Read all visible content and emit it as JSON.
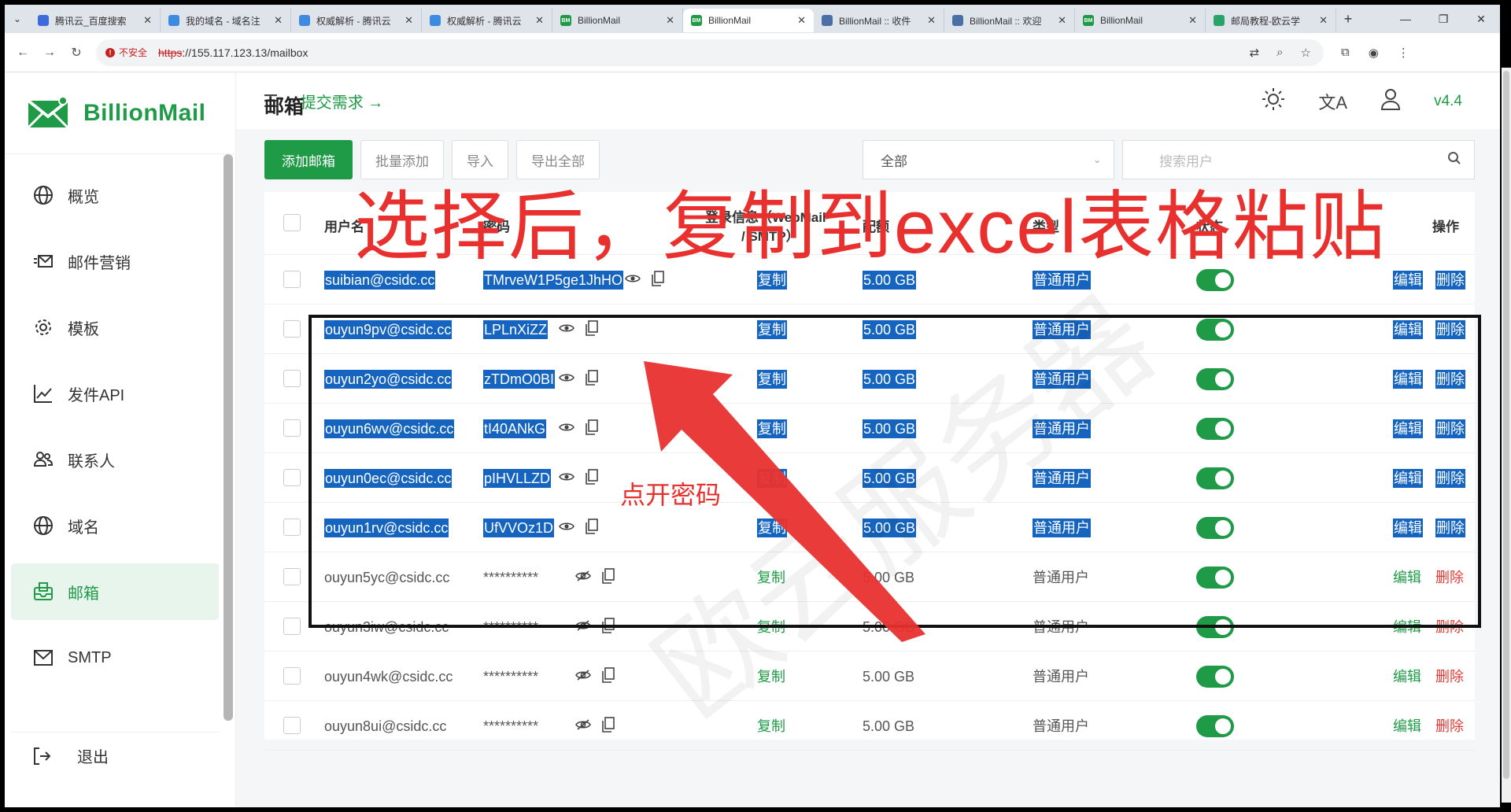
{
  "browser": {
    "tabs": [
      {
        "title": "腾讯云_百度搜索",
        "fav_color": "#3d6bdc",
        "fav_text": ""
      },
      {
        "title": "我的域名 - 域名注",
        "fav_color": "#3d8be0",
        "fav_text": ""
      },
      {
        "title": "权威解析 - 腾讯云",
        "fav_color": "#3d8be0",
        "fav_text": ""
      },
      {
        "title": "权威解析 - 腾讯云",
        "fav_color": "#3d8be0",
        "fav_text": ""
      },
      {
        "title": "BillionMail",
        "fav_color": "#1f9b47",
        "fav_text": "BM"
      },
      {
        "title": "BillionMail",
        "fav_color": "#1f9b47",
        "fav_text": "BM",
        "active": true
      },
      {
        "title": "BillionMail :: 收件",
        "fav_color": "#4a6fa5",
        "fav_text": ""
      },
      {
        "title": "BillionMail :: 欢迎",
        "fav_color": "#4a6fa5",
        "fav_text": ""
      },
      {
        "title": "BillionMail",
        "fav_color": "#1f9b47",
        "fav_text": "BM"
      },
      {
        "title": "邮局教程-欧云学",
        "fav_color": "#2aa36b",
        "fav_text": ""
      }
    ],
    "insecure_label": "不安全",
    "url_scheme": "https",
    "url_rest": "://155.117.123.13/mailbox"
  },
  "app": {
    "logo": "BillionMail",
    "nav": [
      {
        "label": "概览",
        "icon": "globe-icon"
      },
      {
        "label": "邮件营销",
        "icon": "campaign-icon"
      },
      {
        "label": "模板",
        "icon": "gear-icon"
      },
      {
        "label": "发件API",
        "icon": "chart-line-icon"
      },
      {
        "label": "联系人",
        "icon": "contacts-icon"
      },
      {
        "label": "域名",
        "icon": "globe-icon"
      },
      {
        "label": "邮箱",
        "icon": "mailbox-icon",
        "active": true
      },
      {
        "label": "SMTP",
        "icon": "mail-icon"
      }
    ],
    "logout": "退出",
    "header": {
      "submit": "提交需求 →",
      "version": "v4.4"
    },
    "page_title": "邮箱",
    "toolbar": {
      "add": "添加邮箱",
      "batch_add": "批量添加",
      "import": "导入",
      "export": "导出全部",
      "filter": "全部",
      "search_placeholder": "搜索用户"
    },
    "columns": {
      "username": "用户名",
      "password": "密码",
      "login": "登录信息（WebMail",
      "login2": "/ SMTP）",
      "quota": "配额",
      "type": "类型",
      "status": "状态",
      "actions": "操作"
    },
    "rows": [
      {
        "user": "suibian@csidc.cc",
        "pwd": "TMrveW1P5ge1JhHO",
        "copy": "复制",
        "quota": "5.00 GB",
        "type": "普通用户",
        "edit": "编辑",
        "del": "删除",
        "selected": true,
        "shown": true
      },
      {
        "user": "ouyun9pv@csidc.cc",
        "pwd": "LPLnXiZZ",
        "copy": "复制",
        "quota": "5.00 GB",
        "type": "普通用户",
        "edit": "编辑",
        "del": "删除",
        "selected": true,
        "shown": true
      },
      {
        "user": "ouyun2yo@csidc.cc",
        "pwd": "zTDmO0BI",
        "copy": "复制",
        "quota": "5.00 GB",
        "type": "普通用户",
        "edit": "编辑",
        "del": "删除",
        "selected": true,
        "shown": true
      },
      {
        "user": "ouyun6wv@csidc.cc",
        "pwd": "tI40ANkG",
        "copy": "复制",
        "quota": "5.00 GB",
        "type": "普通用户",
        "edit": "编辑",
        "del": "删除",
        "selected": true,
        "shown": true
      },
      {
        "user": "ouyun0ec@csidc.cc",
        "pwd": "pIHVLLZD",
        "copy": "复制",
        "quota": "5.00 GB",
        "type": "普通用户",
        "edit": "编辑",
        "del": "删除",
        "selected": true,
        "shown": true
      },
      {
        "user": "ouyun1rv@csidc.cc",
        "pwd": "UfVVOz1D",
        "copy": "复制",
        "quota": "5.00 GB",
        "type": "普通用户",
        "edit": "编辑",
        "del": "删除",
        "selected": true,
        "shown": true
      },
      {
        "user": "ouyun5yc@csidc.cc",
        "pwd": "**********",
        "copy": "复制",
        "quota": "5.00 GB",
        "type": "普通用户",
        "edit": "编辑",
        "del": "删除",
        "selected": false,
        "shown": false
      },
      {
        "user": "ouyun3iw@csidc.cc",
        "pwd": "**********",
        "copy": "复制",
        "quota": "5.00 GB",
        "type": "普通用户",
        "edit": "编辑",
        "del": "删除",
        "selected": false,
        "shown": false
      },
      {
        "user": "ouyun4wk@csidc.cc",
        "pwd": "**********",
        "copy": "复制",
        "quota": "5.00 GB",
        "type": "普通用户",
        "edit": "编辑",
        "del": "删除",
        "selected": false,
        "shown": false
      },
      {
        "user": "ouyun8ui@csidc.cc",
        "pwd": "**********",
        "copy": "复制",
        "quota": "5.00 GB",
        "type": "普通用户",
        "edit": "编辑",
        "del": "删除",
        "selected": false,
        "shown": false
      }
    ]
  },
  "annotations": {
    "main": "选择后，复制到excel表格粘贴",
    "small": "点开密码",
    "watermark": "欧云服务器",
    "color": "#e8312f"
  }
}
